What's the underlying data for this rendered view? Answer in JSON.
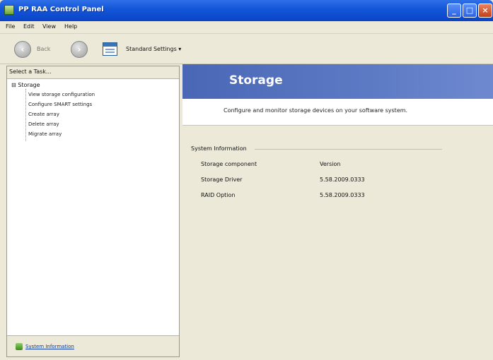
{
  "window": {
    "title": "PP RAA Control Panel",
    "buttons": {
      "minimize": "_",
      "maximize": "□",
      "close": "×"
    }
  },
  "menu": [
    "File",
    "Edit",
    "View",
    "Help"
  ],
  "toolbar": {
    "back_label": "Back",
    "view_label": "Standard Settings",
    "dropdown_glyph": "▾"
  },
  "left_pane": {
    "header": "Select a Task...",
    "root": {
      "expander": "⊟",
      "label": "Storage"
    },
    "tasks": [
      "View storage configuration",
      "Configure SMART settings",
      "Create array",
      "Delete array",
      "Migrate array"
    ],
    "footer_link": "System Information"
  },
  "main": {
    "title": "Storage",
    "description": "Configure and monitor storage devices on your software system.",
    "info_heading": "System Information",
    "info_rows": [
      {
        "key": "Storage component",
        "value": "Version"
      },
      {
        "key": "Storage Driver",
        "value": "5.58.2009.0333"
      },
      {
        "key": "RAID Option",
        "value": "5.58.2009.0333"
      }
    ]
  },
  "colors": {
    "titlebar": "#1457d8",
    "banner": "#5c7ac4",
    "window_bg": "#ece9d8"
  }
}
